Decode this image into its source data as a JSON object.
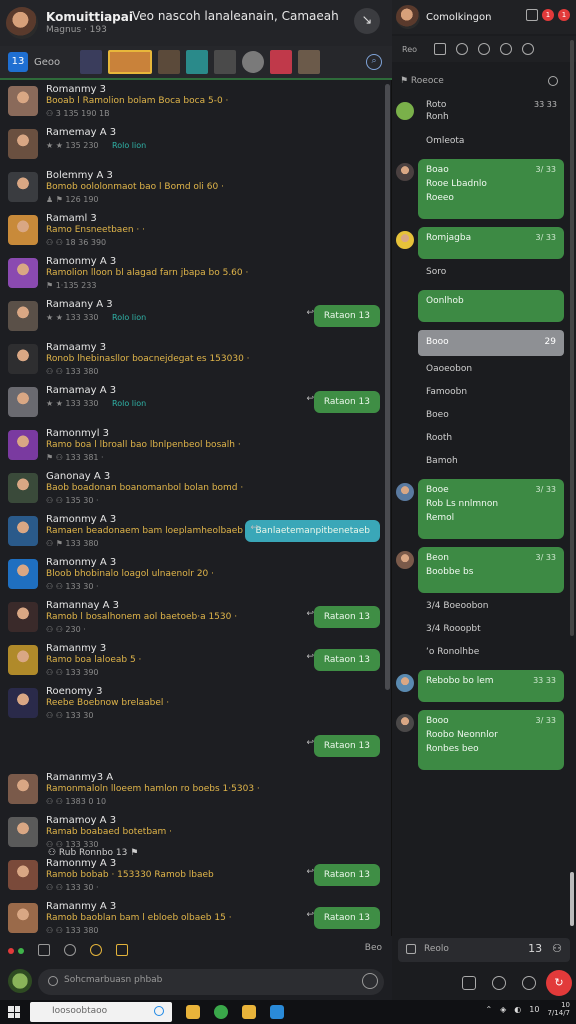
{
  "header": {
    "title": "Komuittiapai",
    "subtitle": "Magnus · 193",
    "center_text": "Veo nascoh lanaleanain, Camaeah",
    "close_glyph": "↘"
  },
  "thumb_strip": {
    "home_label": "13",
    "label": "Geoo",
    "thumb_colors": [
      "#3a3d5c",
      "#c9823a",
      "#5b4a3a",
      "#2a8a8a",
      "#4a4a4a",
      "#7a7a7a",
      "#c0394a",
      "#6b5a4a"
    ],
    "menu_glyph": "⌕"
  },
  "messages": [
    {
      "name": "Romanmy 3",
      "body": "Booab l Ramolion bolam Boca boca 5-0 ·",
      "meta": "⚇ 3 135 190 1B",
      "tag": "",
      "bubble": "",
      "avatar": "#8a6a5a"
    },
    {
      "name": "Ramemay A 3",
      "body": "",
      "meta": "★ ★ 135 230",
      "tag": "Rolo lion",
      "bubble": "",
      "avatar": "#6a5040"
    },
    {
      "name": "Bolemmy A 3",
      "body": "Bomob oololonmaot bao l Bomd oli 60 ·",
      "meta": "♟ ⚑ 126 190",
      "tag": "",
      "bubble": "",
      "avatar": "#3a3c40"
    },
    {
      "name": "Ramaml 3",
      "body": "Ramo Ensneetbaen · ·",
      "meta": "⚇ ⚇ 18 36 390",
      "tag": "",
      "bubble": "",
      "avatar": "#c88a3a"
    },
    {
      "name": "Ramonmy A 3",
      "body": "Ramolion lloon bl alagad farn jbapa bo 5.60 ·",
      "meta": "⚑ 1·135 233",
      "tag": "",
      "bubble": "",
      "avatar": "#8a4ab0"
    },
    {
      "name": "Ramaany A 3",
      "body": "",
      "meta": "★ ★ 133 330",
      "tag": "Rolo lion",
      "bubble": "Rataon  13",
      "avatar": "#5a5048"
    },
    {
      "name": "Ramaamy 3",
      "body": "Ronob lhebinasllor boacnejdegat es 153030 ·",
      "meta": "⚇ ⚇ 133 380",
      "tag": "",
      "bubble": "",
      "avatar": "#2e2e30"
    },
    {
      "name": "Ramamay A 3",
      "body": "",
      "meta": "★ ★ 133 330",
      "tag": "Rolo lion",
      "bubble": "Rataon  13",
      "avatar": "#6a6a70"
    },
    {
      "name": "Ramonmyl 3",
      "body": "Ramo boa l lbroall bao lbnlpenbeol bosalh ·",
      "meta": "⚑ ⚇ 133 381 ·",
      "tag": "",
      "bubble": "",
      "avatar": "#7a3aa0"
    },
    {
      "name": "Ganonay A 3",
      "body": "Baob boadonan boanomanbol bolan bomd ·",
      "meta": "⚇ ⚇ 135 30 ·",
      "tag": "",
      "bubble": "",
      "avatar": "#3a4a3a"
    },
    {
      "name": "Ramonmy A 3",
      "body": "Ramaen beadonaem bam loeplamheolbaeb 5 ·",
      "meta": "⚇ ⚑ 133 380",
      "tag": "",
      "bubble": "Banlaetemanpitbenetaeb",
      "teal": true,
      "avatar": "#2a5a8a"
    },
    {
      "name": "Ramonmy A 3",
      "body": "Bloob bhobinalo loagol ulnaenolr 20 ·",
      "meta": "⚇ ⚇ 133 30 ·",
      "tag": "",
      "bubble": "",
      "avatar": "#1f6fc0"
    },
    {
      "name": "Ramannay A 3",
      "body": "Ramob l bosalhonem aol baetoeb·a 1530 ·",
      "meta": "⚇ ⚇ 230 ·",
      "tag": "",
      "bubble": "Rataon  13",
      "avatar": "#3a2a2a"
    },
    {
      "name": "Ramanmy 3",
      "body": "Ramo boa laloeab 5 ·",
      "meta": "⚇ ⚇ 133 390",
      "tag": "",
      "bubble": "Rataon  13",
      "avatar": "#b08a2a"
    },
    {
      "name": "Roenomy 3",
      "body": "Reebe Boebnow brelaabel ·",
      "meta": "⚇ ⚇ 133 30",
      "tag": "",
      "bubble": "",
      "avatar": "#2a2a4a"
    },
    {
      "name": "",
      "body": "",
      "meta": "",
      "tag": "",
      "bubble": "Rataon  13",
      "avatar": ""
    },
    {
      "name": "Ramanmy3 A",
      "body": "Ramonmaloln lloeem hamlon ro boebs 1·5303 ·",
      "meta": "⚇ ⚇ 1383 0 10",
      "tag": "",
      "bubble": "",
      "avatar": "#7a5a4a"
    },
    {
      "name": "Ramamoy A 3",
      "body": "Ramab boabaed botetbam ·",
      "meta": "⚇ ⚇ 133 330",
      "tag": "",
      "bubble": "",
      "avatar": "#5a5a5a"
    },
    {
      "name": "Ramonmy A 3",
      "body": "Ramob bobab · 153330 Ramob lbaeb",
      "meta": "⚇ ⚇ 133 30 ·",
      "tag": "",
      "bubble": "Rataon  13",
      "avatar": "#7a4a3a"
    },
    {
      "name": "Ramanmy A 3",
      "body": "Ramob baoblan bam l ebloeb olbaeb 15 ·",
      "meta": "⚇ ⚇ 133 380",
      "tag": "",
      "bubble": "Rataon  13",
      "avatar": "#9a6a4a"
    }
  ],
  "plain_row": "⚇  Rub  Ronnbo  13  ⚑",
  "left_toolbar": {
    "right_label": "Beo"
  },
  "search": {
    "placeholder": "Sohcmarbuasn phbab"
  },
  "right": {
    "header_title": "Comolkingon",
    "badges": [
      "1",
      "1"
    ],
    "tab_label": "Reo",
    "search_label": "⚑ Roeoce",
    "feed": [
      {
        "kind": "text",
        "line1": "Roto",
        "line2": "Ronh",
        "time": "33 33",
        "avatar": "#7ab04a"
      },
      {
        "kind": "plain",
        "text": "Omleota"
      },
      {
        "kind": "card",
        "lines": [
          "Boao",
          "Rooe Lbadnlo",
          "Roeeo"
        ],
        "time": "3/ 33",
        "avatar": "#4a4040"
      },
      {
        "kind": "card",
        "lines": [
          "Romjagba"
        ],
        "time": "3/ 33",
        "avatar": "#e6c23a"
      },
      {
        "kind": "plain",
        "text": "Soro"
      },
      {
        "kind": "card",
        "lines": [
          "Oonlhob"
        ],
        "time": "",
        "avatar": ""
      },
      {
        "kind": "gray",
        "text": "Booo",
        "count": "29"
      },
      {
        "kind": "plain",
        "text": "Oaoeobon"
      },
      {
        "kind": "plain",
        "text": "Famoobn"
      },
      {
        "kind": "plain",
        "text": "Boeo"
      },
      {
        "kind": "plain",
        "text": "Rooth"
      },
      {
        "kind": "plain",
        "text": "Bamoh"
      },
      {
        "kind": "card",
        "lines": [
          "Booe",
          "Rob Ls nnlmnon",
          "Remol"
        ],
        "time": "3/ 33",
        "avatar": "#5a7aa0"
      },
      {
        "kind": "card",
        "lines": [
          "Beon",
          "Boobbe bs"
        ],
        "time": "3/ 33",
        "avatar": "#7a5a4a"
      },
      {
        "kind": "plain",
        "text": "3/4  Boeoobon"
      },
      {
        "kind": "plain",
        "text": "3/4  Rooopbt"
      },
      {
        "kind": "plain",
        "text": "ʻo  Ronolhbe"
      },
      {
        "kind": "card",
        "lines": [
          "Rebobo bo lem"
        ],
        "time": "33 33",
        "avatar": "#5a8ab0"
      },
      {
        "kind": "card",
        "lines": [
          "Booo",
          "Roobo Neonnlor",
          "Ronbes beo"
        ],
        "time": "3/ 33",
        "avatar": "#4a4848"
      }
    ],
    "input_label": "Reolo",
    "input_right": [
      "13",
      "⚇"
    ],
    "red_glyph": "↻"
  },
  "taskbar": {
    "search_text": "Ioosoobtaoo",
    "time": "10",
    "date": "7/14/7",
    "tray_text": "10"
  }
}
